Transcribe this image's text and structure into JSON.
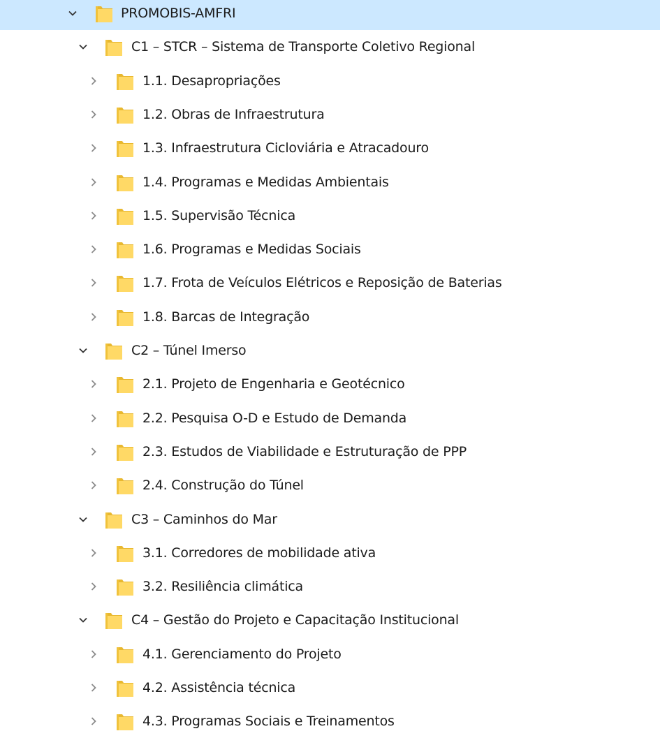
{
  "tree": {
    "root": {
      "label": "PROMOBIS-AMFRI",
      "expanded": true,
      "selected": true,
      "icon": "folder-icon"
    },
    "components": [
      {
        "label": "C1 – STCR – Sistema de Transporte Coletivo Regional",
        "expanded": true,
        "children": [
          "1.1.  Desapropriações",
          "1.2.  Obras de Infraestrutura",
          "1.3.  Infraestrutura  Cicloviária e Atracadouro",
          "1.4. Programas e Medidas Ambientais",
          "1.5. Supervisão Técnica",
          "1.6. Programas e Medidas Sociais",
          "1.7. Frota de Veículos Elétricos e Reposição de Baterias",
          "1.8. Barcas de Integração"
        ]
      },
      {
        "label": "C2 – Túnel Imerso",
        "expanded": true,
        "children": [
          "2.1. Projeto de Engenharia e Geotécnico",
          "2.2. Pesquisa O-D e Estudo de Demanda",
          "2.3. Estudos de Viabilidade e Estruturação de PPP",
          "2.4.  Construção do Túnel"
        ]
      },
      {
        "label": "C3 – Caminhos do Mar",
        "expanded": true,
        "children": [
          "3.1. Corredores de mobilidade ativa",
          "3.2. Resiliência climática"
        ]
      },
      {
        "label": "C4 – Gestão do Projeto e Capacitação Institucional",
        "expanded": true,
        "children": [
          "4.1. Gerenciamento do Projeto",
          "4.2. Assistência técnica",
          "4.3. Programas Sociais e Treinamentos"
        ]
      }
    ]
  },
  "colors": {
    "selection": "#cce8ff",
    "folder_body": "#ffd966",
    "folder_tab": "#f5c542",
    "chevron": "#333333",
    "chevron_collapsed": "#8a8a8a"
  }
}
